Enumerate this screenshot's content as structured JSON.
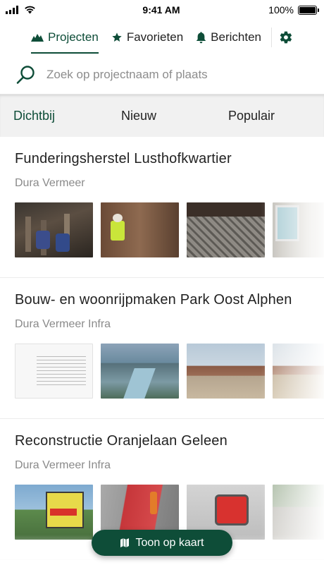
{
  "status_bar": {
    "time": "9:41 AM",
    "battery": "100%"
  },
  "nav": {
    "tabs": [
      {
        "label": "Projecten",
        "icon": "mountains-icon"
      },
      {
        "label": "Favorieten",
        "icon": "star-icon"
      },
      {
        "label": "Berichten",
        "icon": "bell-icon"
      }
    ],
    "settings_icon": "gear-icon",
    "accent_color": "#0e4d38"
  },
  "search": {
    "placeholder": "Zoek op projectnaam of plaats"
  },
  "segments": [
    "Dichtbij",
    "Nieuw",
    "Populair"
  ],
  "projects": [
    {
      "title": "Funderingsherstel Lusthofkwartier",
      "company": "Dura Vermeer"
    },
    {
      "title": "Bouw- en woonrijpmaken Park Oost Alphen",
      "company": "Dura Vermeer Infra"
    },
    {
      "title": "Reconstructie Oranjelaan Geleen",
      "company": "Dura Vermeer Infra"
    }
  ],
  "map_button": {
    "label": "Toon op kaart",
    "icon": "map-icon"
  }
}
